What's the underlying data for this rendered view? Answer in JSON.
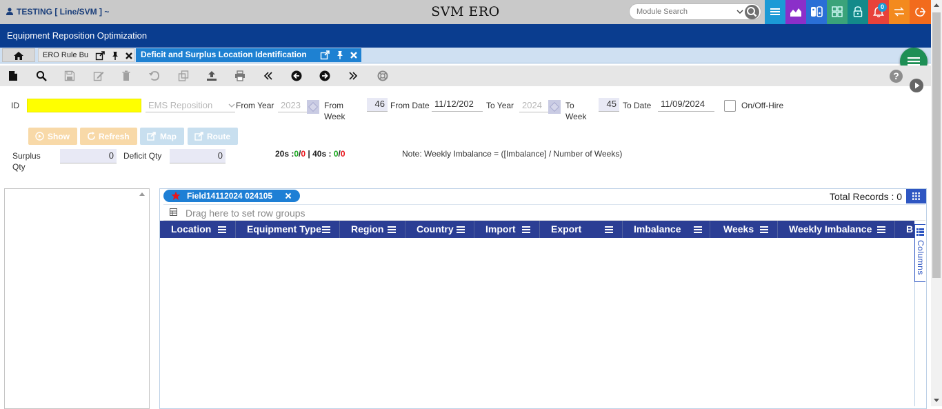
{
  "topbar": {
    "user": "TESTING [ Line/SVM ] ~",
    "app_title": "SVM ERO",
    "search_placeholder": "Module Search",
    "notification_count": "0",
    "quick_icons": [
      {
        "name": "menu-icon",
        "color": "#1b9ad6"
      },
      {
        "name": "chart-icon",
        "color": "#8b2fc9"
      },
      {
        "name": "switch-icon",
        "color": "#2a6fd6"
      },
      {
        "name": "grid-apps-icon",
        "color": "#3aa37a"
      },
      {
        "name": "lock-icon",
        "color": "#138a8a"
      },
      {
        "name": "bell-icon",
        "color": "#e8423a"
      },
      {
        "name": "transfer-icon",
        "color": "#f38a1e"
      },
      {
        "name": "logout-icon",
        "color": "#f26b1d"
      }
    ]
  },
  "header": {
    "module_title": "Equipment Reposition Optimization"
  },
  "tabs": {
    "ero_rule": "ERO Rule Bu",
    "active": "Deficit and Surplus Location Identification"
  },
  "form": {
    "id_label": "ID",
    "id_value": "",
    "ems_value": "EMS Reposition",
    "from_year_label": "From Year",
    "from_year_value": "2023",
    "from_week_label_1": "From",
    "from_week_label_2": "Week",
    "from_week_value": "46",
    "from_date_label": "From Date",
    "from_date_value": "11/12/202",
    "to_year_label": "To Year",
    "to_year_value": "2024",
    "to_week_label_1": "To",
    "to_week_label_2": "Week",
    "to_week_value": "45",
    "to_date_label": "To Date",
    "to_date_value": "11/09/2024",
    "onoff_label": "On/Off-Hire",
    "surplus_label_1": "Surplus",
    "surplus_label_2": "Qty",
    "surplus_value": "0",
    "deficit_label": "Deficit Qty",
    "deficit_value": "0"
  },
  "buttons": {
    "show": "Show",
    "refresh": "Refresh",
    "map": "Map",
    "route": "Route"
  },
  "summary": {
    "p20": "20s :",
    "v20a": "0",
    "sep1": "/",
    "v20b": "0",
    "mid": "| 40s :",
    "v40a": "0",
    "sep2": "/",
    "v40b": "0"
  },
  "note": "Note: Weekly Imbalance = ([Imbalance] / Number of Weeks)",
  "grid": {
    "chip": "Field14112024 024105",
    "total_records": "Total Records : 0",
    "group_hint": "Drag here to set row groups",
    "columns_label": "Columns",
    "columns": [
      "Location",
      "Equipment Type",
      "Region",
      "Country",
      "Import",
      "Export",
      "Imbalance",
      "Weeks",
      "Weekly Imbalance",
      "B"
    ]
  }
}
